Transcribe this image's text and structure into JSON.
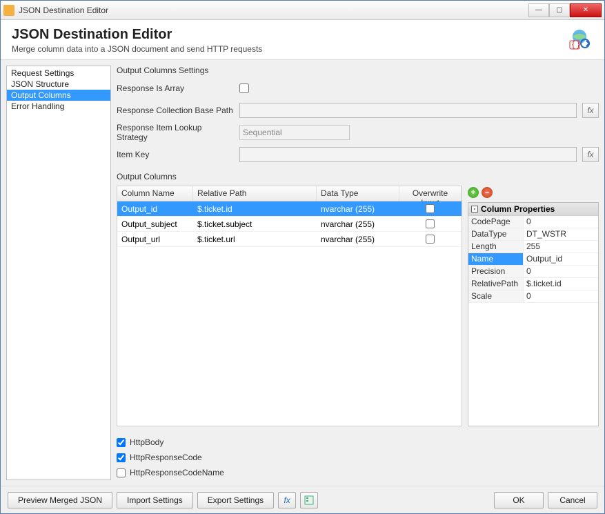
{
  "window": {
    "title": "JSON Destination Editor"
  },
  "header": {
    "title": "JSON Destination Editor",
    "subtitle": "Merge column data into a JSON document and send HTTP requests"
  },
  "sidebar": {
    "items": [
      {
        "label": "Request Settings",
        "selected": false
      },
      {
        "label": "JSON Structure",
        "selected": false
      },
      {
        "label": "Output Columns",
        "selected": true
      },
      {
        "label": "Error Handling",
        "selected": false
      }
    ]
  },
  "settings": {
    "section_label": "Output Columns Settings",
    "response_is_array_label": "Response Is Array",
    "response_is_array": false,
    "base_path_label": "Response Collection Base Path",
    "base_path_value": "",
    "lookup_label": "Response Item Lookup Strategy",
    "lookup_value": "Sequential",
    "item_key_label": "Item Key",
    "item_key_value": ""
  },
  "columns": {
    "section_label": "Output Columns",
    "headers": {
      "name": "Column Name",
      "path": "Relative Path",
      "type": "Data Type",
      "overwrite": "Overwrite Input"
    },
    "rows": [
      {
        "name": "Output_id",
        "path": "$.ticket.id",
        "type": "nvarchar (255)",
        "overwrite": false,
        "selected": true
      },
      {
        "name": "Output_subject",
        "path": "$.ticket.subject",
        "type": "nvarchar (255)",
        "overwrite": false,
        "selected": false
      },
      {
        "name": "Output_url",
        "path": "$.ticket.url",
        "type": "nvarchar (255)",
        "overwrite": false,
        "selected": false
      }
    ]
  },
  "properties": {
    "header": "Column Properties",
    "rows": [
      {
        "key": "CodePage",
        "value": "0"
      },
      {
        "key": "DataType",
        "value": "DT_WSTR"
      },
      {
        "key": "Length",
        "value": "255"
      },
      {
        "key": "Name",
        "value": "Output_id",
        "selected": true
      },
      {
        "key": "Precision",
        "value": "0"
      },
      {
        "key": "RelativePath",
        "value": "$.ticket.id"
      },
      {
        "key": "Scale",
        "value": "0"
      }
    ]
  },
  "http": {
    "body_label": "HttpBody",
    "body": true,
    "code_label": "HttpResponseCode",
    "code": true,
    "codename_label": "HttpResponseCodeName",
    "codename": false
  },
  "footer": {
    "preview": "Preview Merged JSON",
    "import": "Import Settings",
    "export": "Export Settings",
    "ok": "OK",
    "cancel": "Cancel"
  },
  "fx": "fx"
}
